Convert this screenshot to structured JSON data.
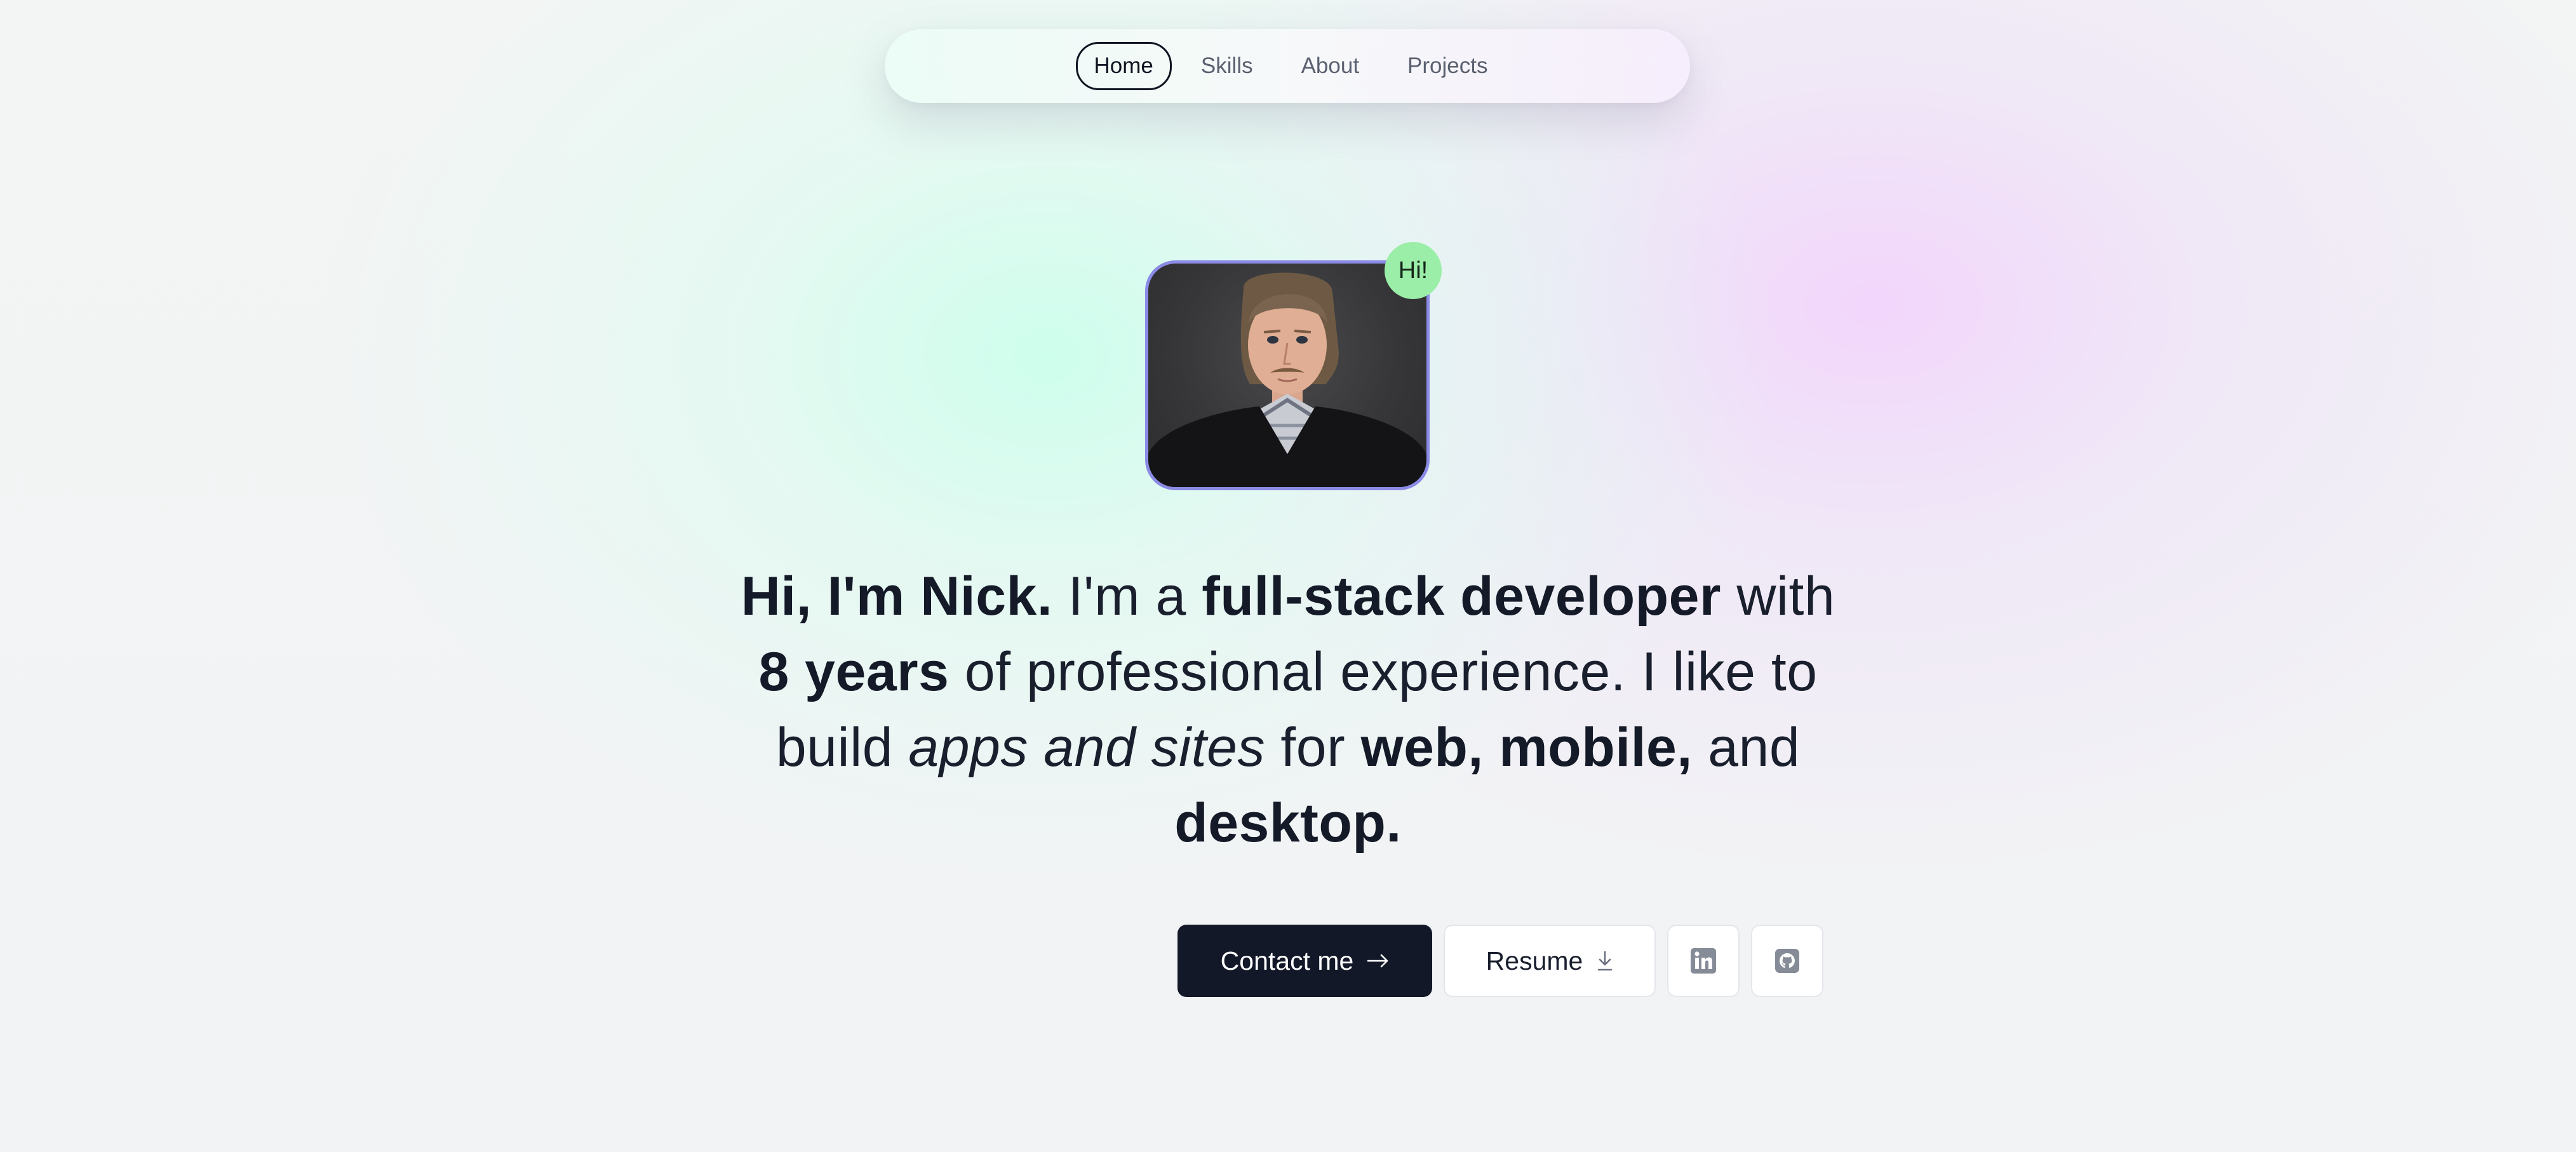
{
  "nav": {
    "items": [
      {
        "label": "Home",
        "active": true
      },
      {
        "label": "Skills",
        "active": false
      },
      {
        "label": "About",
        "active": false
      },
      {
        "label": "Projects",
        "active": false
      }
    ]
  },
  "hero": {
    "badge": "Hi!",
    "avatar_icon": "portrait-photo",
    "headline": {
      "intro": "Hi, I'm Nick.",
      "t1": " I'm a ",
      "role": "full-stack developer",
      "t2": " with ",
      "years": "8 years",
      "t3": " of professional experience. I like to build ",
      "things": "apps and sites",
      "t4": " for ",
      "platforms": "web, mobile,",
      "t5": " and ",
      "last": "desktop."
    }
  },
  "actions": {
    "contact_label": "Contact me",
    "contact_icon": "arrow-right-icon",
    "resume_label": "Resume",
    "resume_icon": "download-icon",
    "linkedin_icon": "linkedin-icon",
    "github_icon": "github-icon"
  },
  "colors": {
    "primary_button": "#121827",
    "badge": "#9beea7",
    "avatar_border": "#8b8be6"
  }
}
